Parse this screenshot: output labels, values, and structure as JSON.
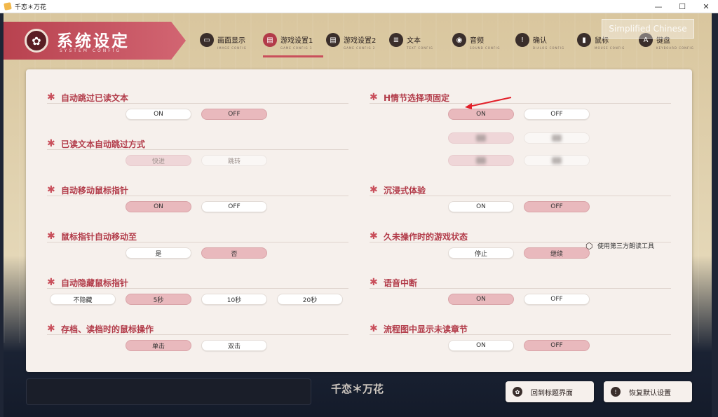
{
  "window": {
    "title": "千恋＊万花",
    "minimize": "—",
    "maximize": "☐",
    "close": "✕"
  },
  "header": {
    "title": "系统设定",
    "subtitle": "SYSTEM CONFIG",
    "gear_glyph": "✿"
  },
  "language_hint": "Simplified Chinese",
  "tabs": [
    {
      "label": "画面显示",
      "sub": "IMAGE CONFIG",
      "icon": "monitor-icon",
      "glyph": "▭"
    },
    {
      "label": "游戏设置1",
      "sub": "GAME CONFIG 1",
      "icon": "game-icon",
      "glyph": "▤",
      "active": true
    },
    {
      "label": "游戏设置2",
      "sub": "GAME CONFIG 2",
      "icon": "game-icon",
      "glyph": "▤"
    },
    {
      "label": "文本",
      "sub": "TEXT CONFIG",
      "icon": "text-icon",
      "glyph": "≣"
    },
    {
      "label": "音频",
      "sub": "SOUND CONFIG",
      "icon": "sound-icon",
      "glyph": "◉"
    },
    {
      "label": "确认",
      "sub": "DIALOG CONFIG",
      "icon": "alert-icon",
      "glyph": "!"
    },
    {
      "label": "鼠标",
      "sub": "MOUSE CONFIG",
      "icon": "mouse-icon",
      "glyph": "▮"
    },
    {
      "label": "键盘",
      "sub": "KEYBOARD CONFIG",
      "icon": "keyboard-icon",
      "glyph": "A"
    }
  ],
  "settings": {
    "auto_skip_read": {
      "label": "自动跳过已读文本",
      "options": [
        "ON",
        "OFF"
      ],
      "selected": "OFF"
    },
    "skip_mode": {
      "label": "已读文本自动跳过方式",
      "options": [
        "快进",
        "跳转"
      ],
      "selected": "快进",
      "disabled": true
    },
    "auto_move_cursor": {
      "label": "自动移动鼠标指针",
      "options": [
        "ON",
        "OFF"
      ],
      "selected": "ON"
    },
    "cursor_target": {
      "label": "鼠标指针自动移动至",
      "options": [
        "是",
        "否"
      ],
      "selected": "否"
    },
    "auto_hide_cursor": {
      "label": "自动隐藏鼠标指针",
      "options": [
        "不隐藏",
        "5秒",
        "10秒",
        "20秒"
      ],
      "selected": "5秒"
    },
    "save_load_click": {
      "label": "存档、读档时的鼠标操作",
      "options": [
        "单击",
        "双击"
      ],
      "selected": "单击"
    },
    "h_scene_choice": {
      "label": "H情节选择项固定",
      "options": [
        "ON",
        "OFF"
      ],
      "selected": "ON"
    },
    "immersive": {
      "label": "沉浸式体验",
      "options": [
        "ON",
        "OFF"
      ],
      "selected": "OFF",
      "extra": "使用第三方朗读工具"
    },
    "idle_state": {
      "label": "久未操作时的游戏状态",
      "options": [
        "停止",
        "继续"
      ],
      "selected": "继续"
    },
    "voice_interrupt": {
      "label": "语音中断",
      "options": [
        "ON",
        "OFF"
      ],
      "selected": "ON"
    },
    "flowchart_unread": {
      "label": "流程图中显示未读章节",
      "options": [
        "ON",
        "OFF"
      ],
      "selected": "OFF"
    }
  },
  "footer": {
    "logo": "千恋＊万花",
    "back_to_title": "回到标题界面",
    "restore_defaults": "恢复默认设置"
  },
  "colors": {
    "accent": "#c94f5b",
    "selected": "#e9b9bd"
  }
}
